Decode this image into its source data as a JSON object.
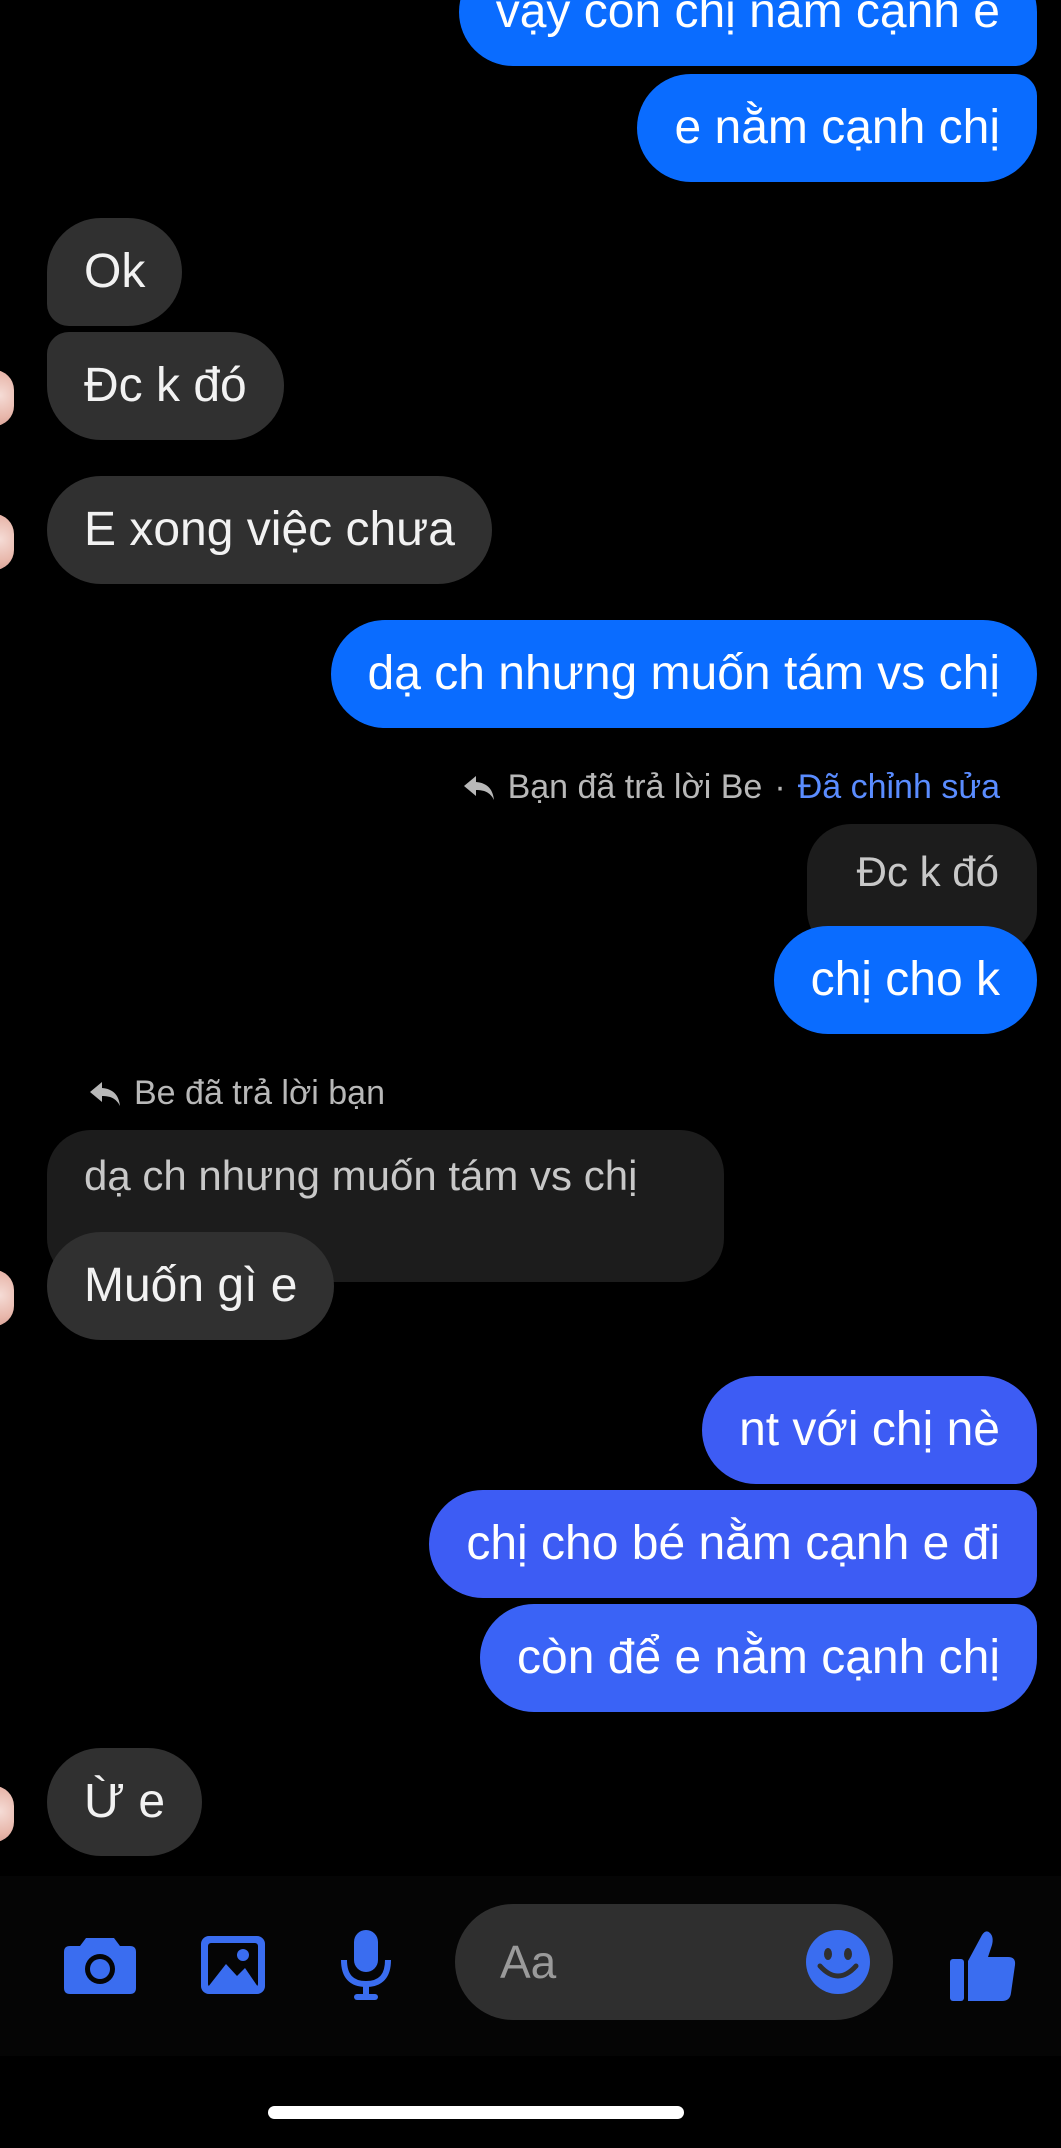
{
  "colors": {
    "sent_bubble": "#0a6cff",
    "sent_bubble_violet": "#3d5cf4",
    "received_bubble": "#303030",
    "quoted_bubble": "#1c1c1c",
    "icon_accent": "#3a6df0",
    "edited_label": "#5a8cff"
  },
  "messages": [
    {
      "text": "vậy còn chị nằm cạnh e"
    },
    {
      "text": "e nằm cạnh chị"
    },
    {
      "text": "Ok"
    },
    {
      "text": "Đc k đó"
    },
    {
      "text": "E xong việc chưa"
    },
    {
      "text": "dạ ch nhưng muốn tám vs chị"
    },
    {
      "text": "chị cho k"
    },
    {
      "text": "Muốn gì e"
    },
    {
      "text": "nt với chị nè"
    },
    {
      "text": "chị cho bé nằm cạnh e đi"
    },
    {
      "text": "còn để e nằm cạnh chị"
    },
    {
      "text": "Ừ e"
    }
  ],
  "replies": {
    "sent_reply_meta": "Bạn đã trả lời Be",
    "sent_reply_separator": "·",
    "sent_reply_edited": "Đã chỉnh sửa",
    "sent_reply_quote": "Đc k đó",
    "recv_reply_meta": "Be đã trả lời bạn",
    "recv_reply_quote": "dạ ch nhưng muốn tám vs chị"
  },
  "composer": {
    "placeholder": "Aa",
    "icons": [
      "camera-icon",
      "photo-icon",
      "microphone-icon",
      "emoji-icon",
      "thumbs-up-icon"
    ]
  }
}
